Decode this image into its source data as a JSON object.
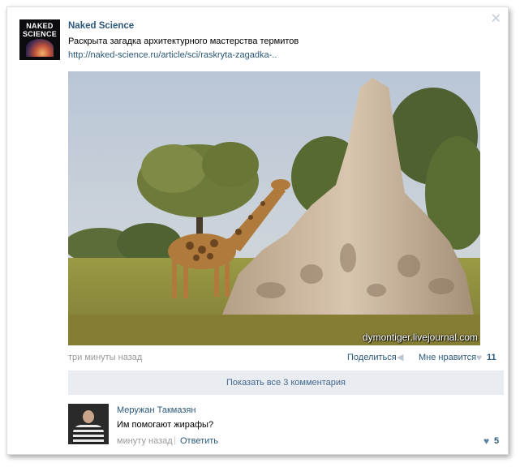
{
  "post": {
    "author": "Naked Science",
    "avatar_logo_line1": "NAKED",
    "avatar_logo_line2": "SCIENCE",
    "text": "Раскрыта загадка архитектурного мастерства термитов",
    "link": "http://naked-science.ru/article/sci/raskryta-zagadka-..",
    "photo_watermark": "dymontiger.livejournal.com",
    "time": "три минуты назад",
    "share_label": "Поделиться",
    "like_label": "Мне нравится",
    "like_count": "11",
    "show_comments": "Показать все 3 комментария",
    "icons": {
      "close": "close-icon",
      "share": "megaphone-icon",
      "like": "heart-icon"
    }
  },
  "comment": {
    "author": "Меружан Такмазян",
    "text": "Им помогают жирафы?",
    "time": "минуту назад",
    "reply_label": "Ответить",
    "like_count": "5"
  },
  "colors": {
    "link": "#2b587a",
    "muted": "#999999",
    "bar": "#e9edf1"
  }
}
